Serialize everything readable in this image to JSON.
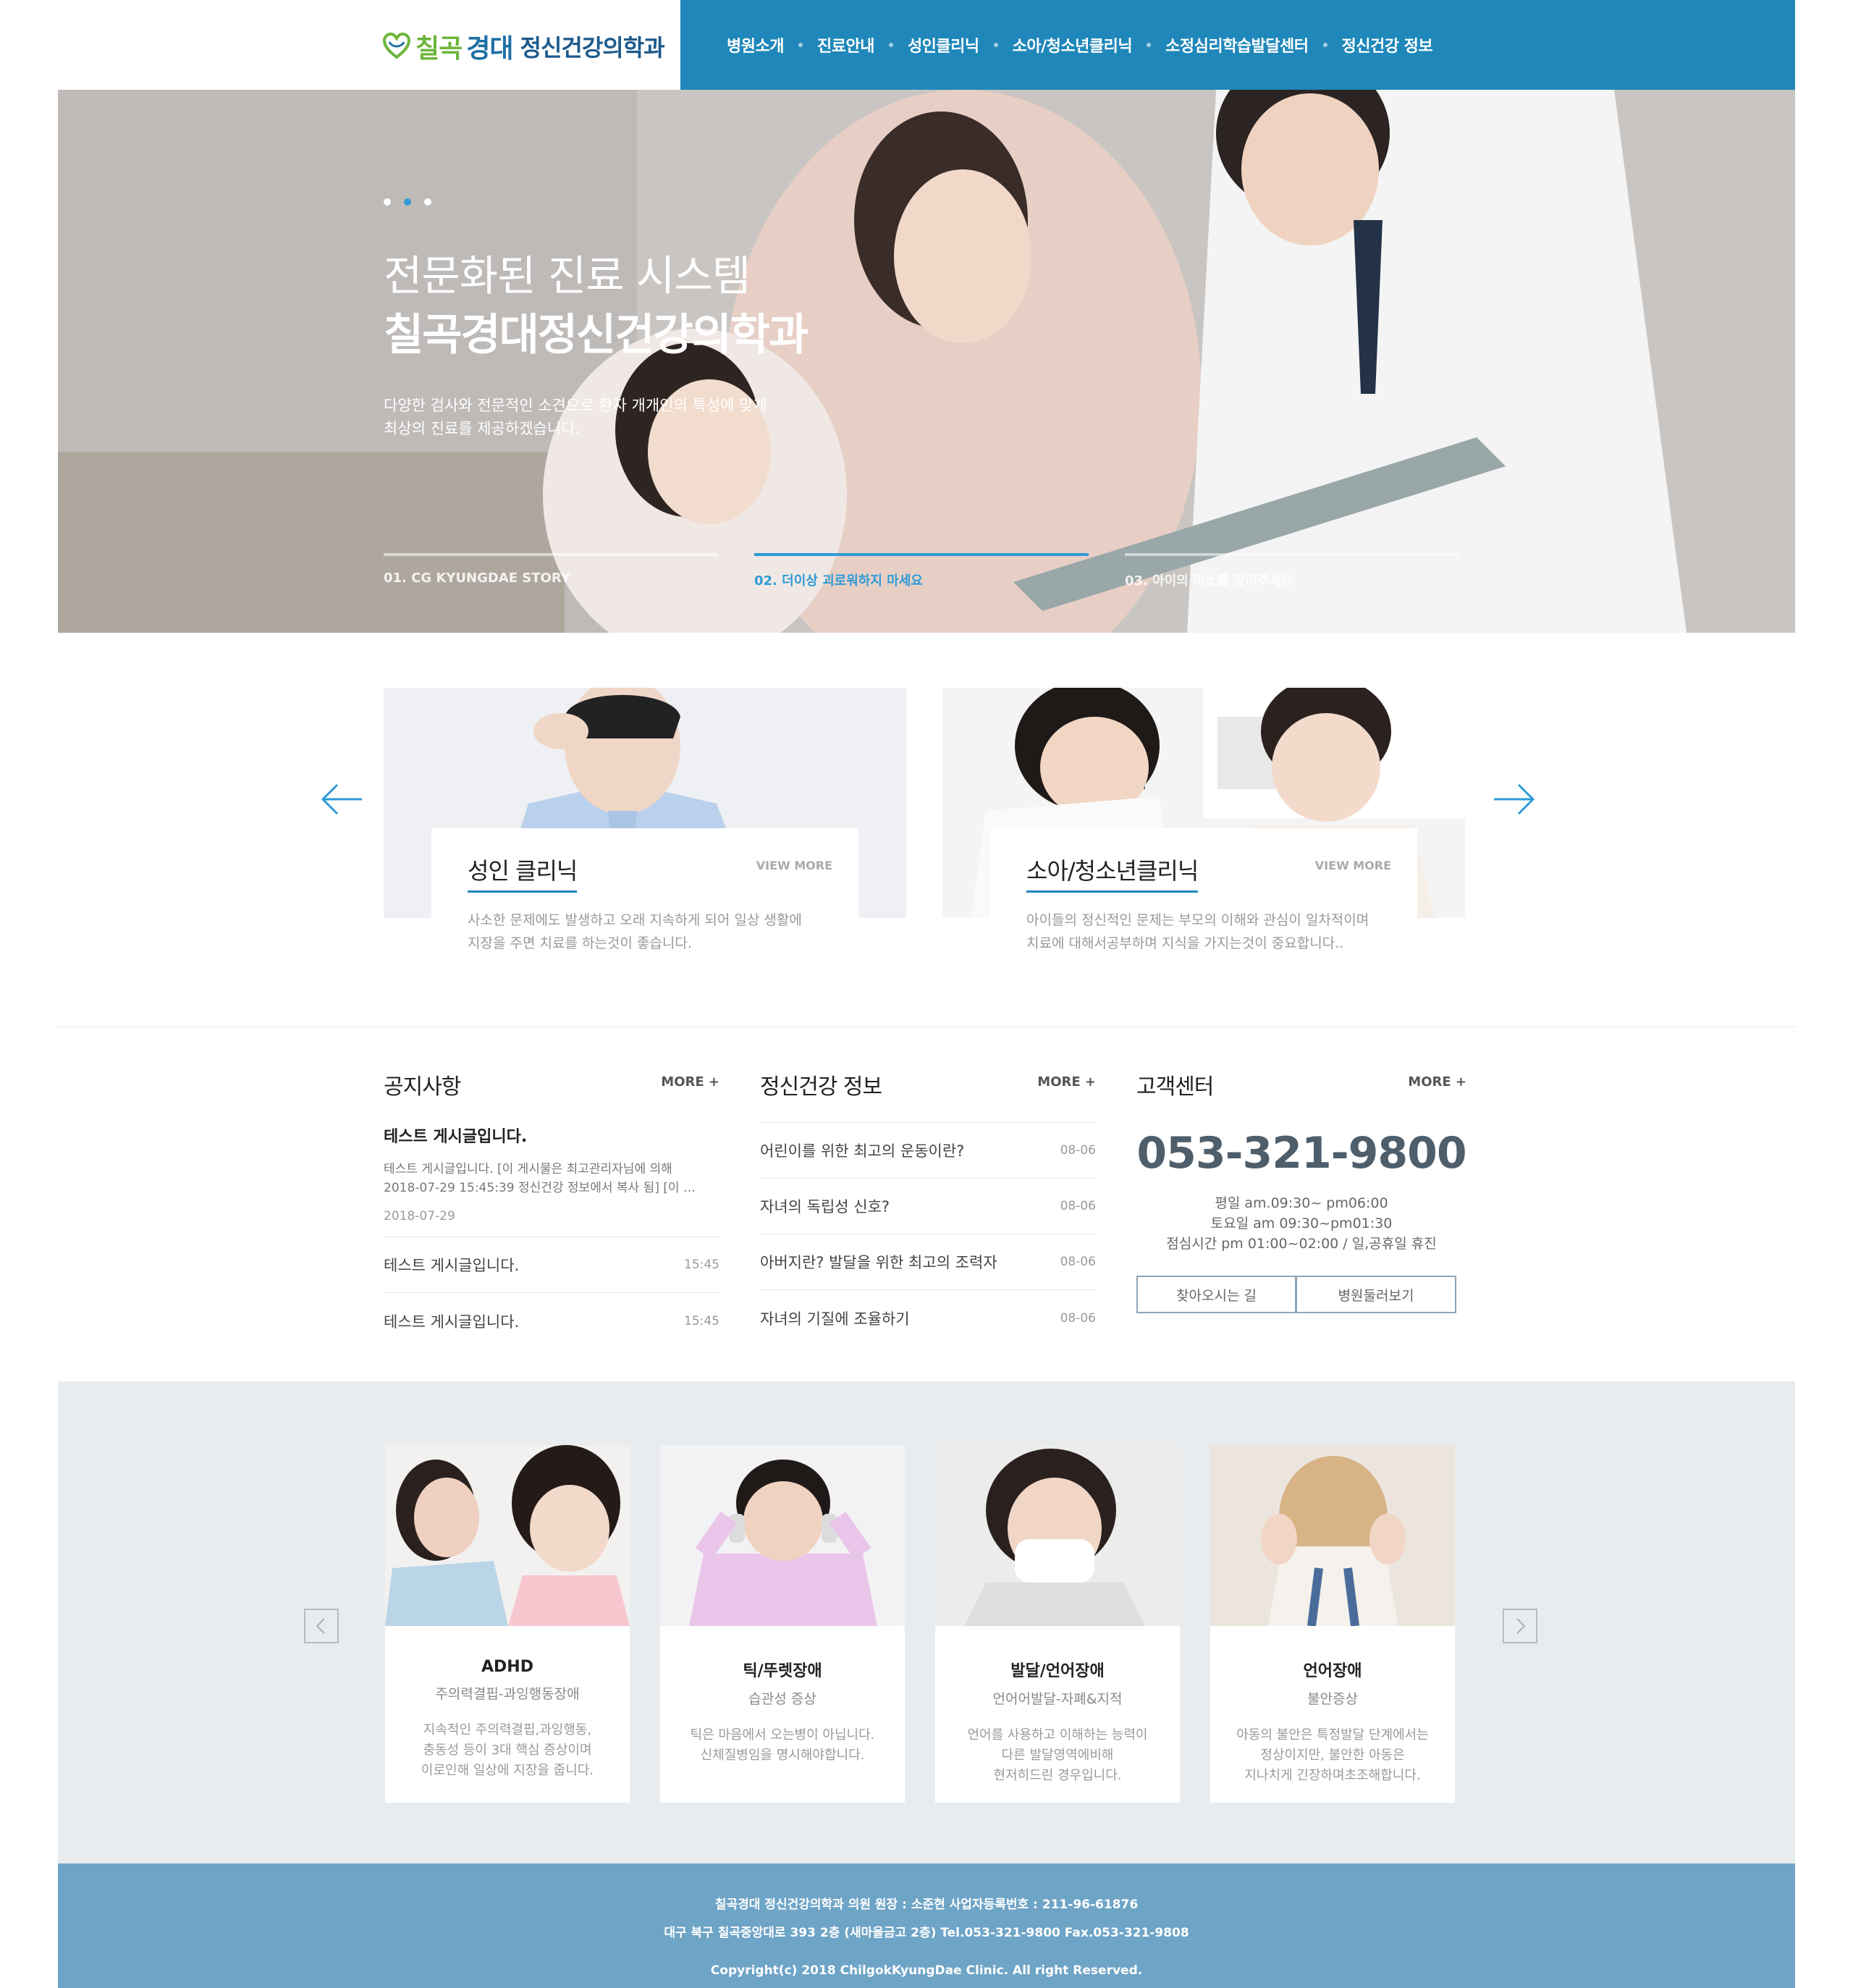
{
  "header": {
    "logo": {
      "part1": "칠곡",
      "part2": "경대",
      "part3": "정신건강의학과"
    },
    "nav": [
      "병원소개",
      "진료안내",
      "성인클리닉",
      "소아/청소년클리닉",
      "소정심리학습발달센터",
      "정신건강 정보"
    ]
  },
  "hero": {
    "title1": "전문화된 진료 시스템",
    "title2": "칠곡경대정신건강의학과",
    "desc_line1": "다양한 검사와 전문적인 소견으로 환자 개개인의 특성에 맞게",
    "desc_line2": "최상의 진료를 제공하겠습니다.",
    "active_slide": 2,
    "tabs": [
      "01. CG KYUNGDAE STORY",
      "02. 더이상 괴로워하지 마세요",
      "03. 아이의 미소를 찾아주세요"
    ]
  },
  "clinics": [
    {
      "title": "성인 클리닉",
      "more": "VIEW MORE",
      "desc_line1": "사소한 문제에도 발생하고 오래 지속하게 되어 일상 생활에",
      "desc_line2": "지장을 주면 치료를 하는것이 좋습니다."
    },
    {
      "title": "소아/청소년클리닉",
      "more": "VIEW MORE",
      "desc_line1": "아이들의 정신적인 문제는 부모의 이해와 관심이 일차적이며",
      "desc_line2": "치료에 대해서공부하며 지식을 가지는것이 중요합니다.."
    }
  ],
  "notice": {
    "title": "공지사항",
    "more": "MORE +",
    "featured": {
      "title": "테스트 게시글입니다.",
      "desc_line1": "테스트 게시글입니다. [이 게시물은 최고관리자님에 의해",
      "desc_line2": "2018-07-29 15:45:39 정신건강 정보에서 복사 됨] [이 …",
      "date": "2018-07-29"
    },
    "items": [
      {
        "text": "테스트 게시글입니다.",
        "date": "15:45"
      },
      {
        "text": "테스트 게시글입니다.",
        "date": "15:45"
      }
    ]
  },
  "health_info": {
    "title": "정신건강 정보",
    "more": "MORE +",
    "items": [
      {
        "text": "어린이를 위한 최고의 운동이란?",
        "date": "08-06"
      },
      {
        "text": "자녀의 독립성 신호?",
        "date": "08-06"
      },
      {
        "text": "아버지란? 발달을 위한 최고의 조력자",
        "date": "08-06"
      },
      {
        "text": "자녀의 기질에 조율하기",
        "date": "08-06"
      }
    ]
  },
  "customer": {
    "title": "고객센터",
    "more": "MORE +",
    "phone": "053-321-9800",
    "hours1": "평일 am.09:30~ pm06:00",
    "hours2": "토요일 am 09:30~pm01:30",
    "hours3": "점심시간 pm 01:00~02:00 / 일,공휴일 휴진",
    "btn_directions": "찾아오시는 길",
    "btn_tour": "병원둘러보기"
  },
  "disorders": [
    {
      "name": "ADHD",
      "sub": "주의력결핍-과잉행동장애",
      "desc1": "지속적인 주의력결핍,과잉행동,",
      "desc2": "충동성 등이 3대 핵심 증상이며",
      "desc3": "이로인해 일상에 지장을 줍니다."
    },
    {
      "name": "틱/뚜렛장애",
      "sub": "습관성 증상",
      "desc1": "틱은 마음에서 오는병이 아닙니다.",
      "desc2": "신체질병임을 명시해야합니다.",
      "desc3": ""
    },
    {
      "name": "발달/언어장애",
      "sub": "언어어발달-자폐&지적",
      "desc1": "언어를 사용하고 이해하는 능력이",
      "desc2": "다른 발달영역에비해",
      "desc3": "현저히드린 경우입니다."
    },
    {
      "name": "언어장애",
      "sub": "불안증상",
      "desc1": "아동의 불안은 특정발달 단계에서는",
      "desc2": "정상이지만, 불안한 아동은",
      "desc3": "지나치게 긴장하며초조해합니다."
    }
  ],
  "footer": {
    "line1": "칠곡경대 정신건강의학과 의원 원장 : 소준현 사업자등록번호 : 211-96-61876",
    "line2": "대구 북구 칠곡중앙대로 393 2층 (새마을금고 2층) Tel.053-321-9800 Fax.053-321-9808",
    "copyright": "Copyright(c) 2018 ChilgokKyungDae Clinic. All right Reserved."
  },
  "colors": {
    "primary": "#1f87b9",
    "footer": "#6ea4c6",
    "gray_bg": "#e9ecef"
  }
}
